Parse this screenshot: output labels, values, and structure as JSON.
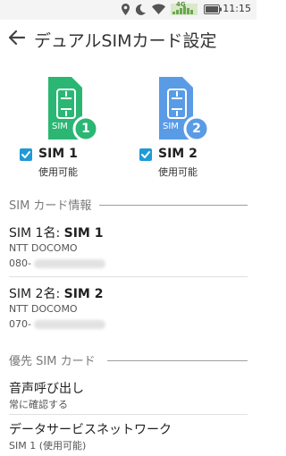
{
  "status_bar": {
    "time": "11:15",
    "icons": [
      "location-icon",
      "moon-icon",
      "wifi-icon",
      "signal-icon",
      "battery-icon"
    ],
    "signal_label": "4G"
  },
  "header": {
    "title": "デュアルSIMカード設定"
  },
  "sims": [
    {
      "card_label": "SIM",
      "number": "1",
      "name": "SIM 1",
      "status": "使用可能",
      "checked": true,
      "color": "#2bb673"
    },
    {
      "card_label": "SIM",
      "number": "2",
      "name": "SIM 2",
      "status": "使用可能",
      "checked": true,
      "color": "#5a9be6"
    }
  ],
  "info_section": {
    "header": "SIM カード情報",
    "items": [
      {
        "name_prefix": "SIM 1名: ",
        "name_value": "SIM 1",
        "carrier": "NTT DOCOMO",
        "number_prefix": "080-"
      },
      {
        "name_prefix": "SIM 2名: ",
        "name_value": "SIM 2",
        "carrier": "NTT DOCOMO",
        "number_prefix": "070-"
      }
    ]
  },
  "priority_section": {
    "header": "優先 SIM カード",
    "items": [
      {
        "title": "音声呼び出し",
        "value": "常に確認する"
      },
      {
        "title": "データサービスネットワーク",
        "value": "SIM 1 (使用可能)"
      }
    ]
  },
  "colors": {
    "accent": "#1e9ad6",
    "sim1": "#2bb673",
    "sim2": "#5a9be6"
  }
}
